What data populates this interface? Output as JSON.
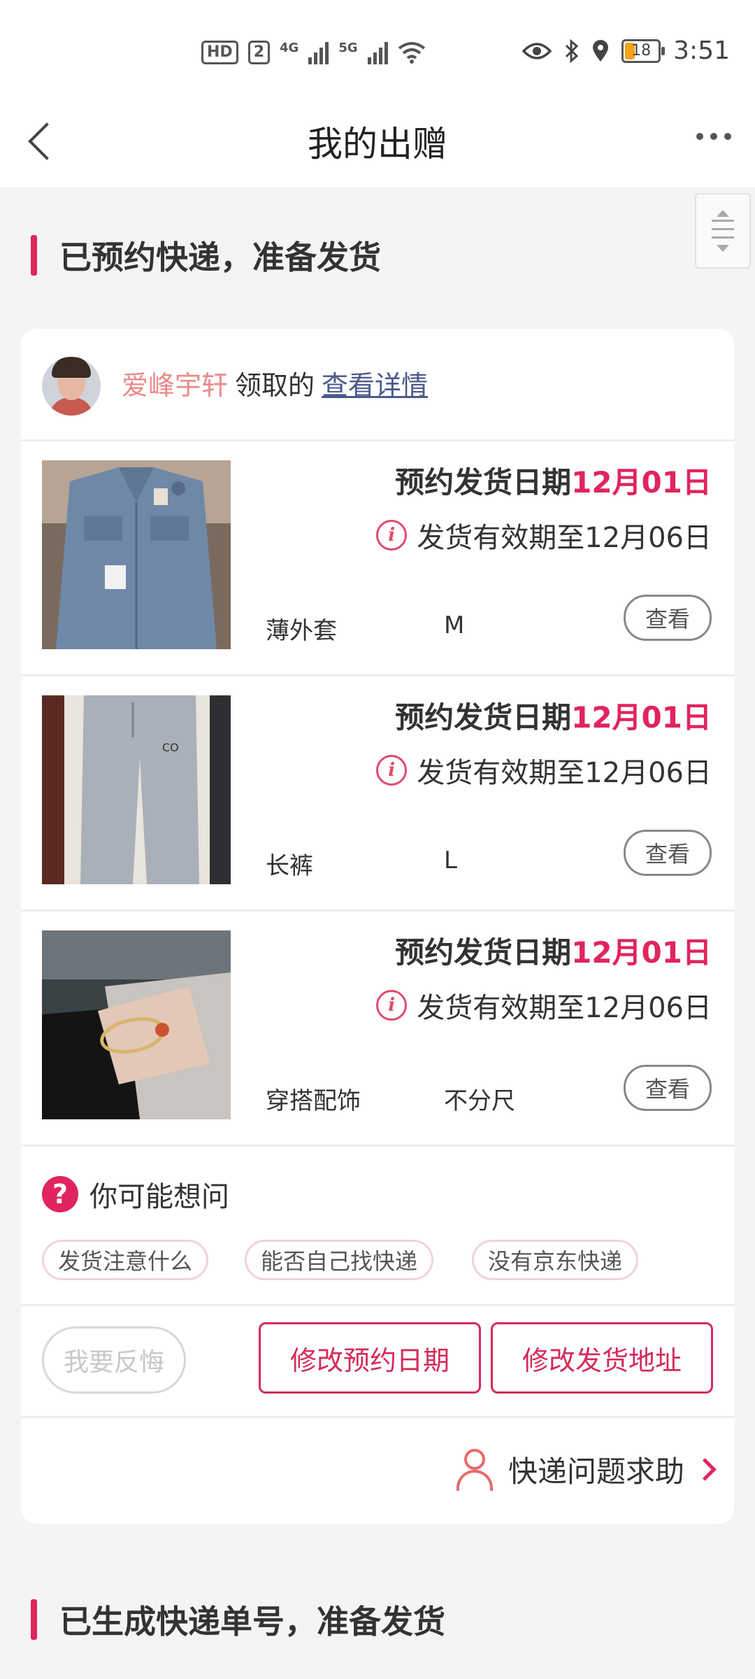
{
  "status_bar": {
    "hd": "HD",
    "sim": "2",
    "net1": "4G",
    "net2": "5G",
    "battery": "18",
    "time": "3:51"
  },
  "nav": {
    "title": "我的出赠"
  },
  "sections": [
    {
      "title": "已预约快递，准备发货"
    },
    {
      "title": "已生成快递单号，准备发货"
    }
  ],
  "card": {
    "header": {
      "user": "爱峰宇轩",
      "claimed": "领取的",
      "detail_link": "查看详情"
    },
    "items": [
      {
        "ship_label": "预约发货日期",
        "ship_date": "12月01日",
        "valid": "发货有效期至12月06日",
        "name": "薄外套",
        "size": "M",
        "view": "查看",
        "thumb": "denim-jacket-image"
      },
      {
        "ship_label": "预约发货日期",
        "ship_date": "12月01日",
        "valid": "发货有效期至12月06日",
        "name": "长裤",
        "size": "L",
        "view": "查看",
        "thumb": "gray-pants-image"
      },
      {
        "ship_label": "预约发货日期",
        "ship_date": "12月01日",
        "valid": "发货有效期至12月06日",
        "name": "穿搭配饰",
        "size": "不分尺",
        "view": "查看",
        "thumb": "bracelet-image"
      }
    ],
    "faq": {
      "title": "你可能想问",
      "chips": [
        "发货注意什么",
        "能否自己找快递",
        "没有京东快递"
      ]
    },
    "actions": {
      "regret": "我要反悔",
      "change_date": "修改预约日期",
      "change_address": "修改发货地址"
    },
    "help": {
      "label": "快递问题求助"
    }
  },
  "colors": {
    "accent": "#e0245e",
    "link": "#4a5a8c",
    "username": "#ec8a8a"
  }
}
